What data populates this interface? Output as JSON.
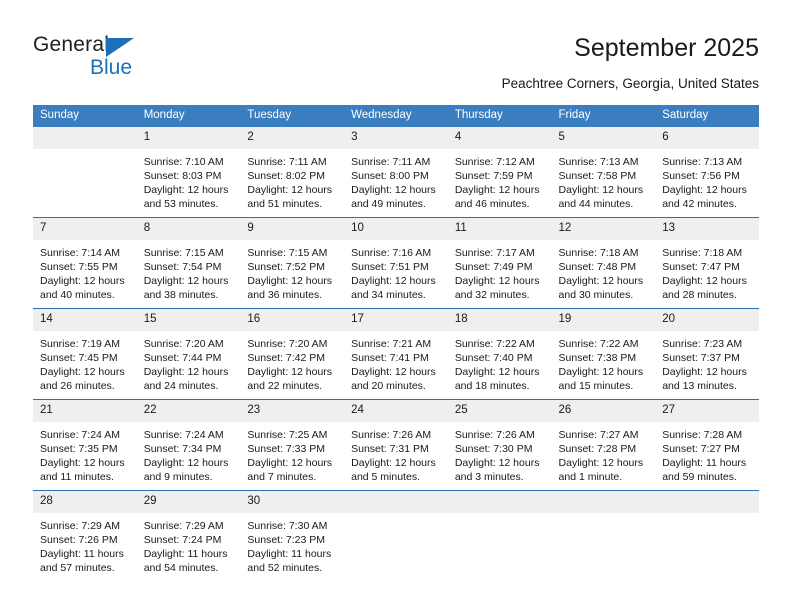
{
  "brand": {
    "name_top": "General",
    "name_bottom": "Blue",
    "accent_color": "#1d70b7"
  },
  "header": {
    "title": "September 2025",
    "subtitle": "Peachtree Corners, Georgia, United States"
  },
  "calendar": {
    "header_bg": "#3a7ebf",
    "daynum_bg": "#efefef",
    "weekday_headers": [
      "Sunday",
      "Monday",
      "Tuesday",
      "Wednesday",
      "Thursday",
      "Friday",
      "Saturday"
    ],
    "labels": {
      "sunrise": "Sunrise:",
      "sunset": "Sunset:",
      "daylight": "Daylight:"
    },
    "weeks": [
      [
        {
          "day": ""
        },
        {
          "day": "1",
          "sunrise": "Sunrise: 7:10 AM",
          "sunset": "Sunset: 8:03 PM",
          "daylight": "Daylight: 12 hours and 53 minutes."
        },
        {
          "day": "2",
          "sunrise": "Sunrise: 7:11 AM",
          "sunset": "Sunset: 8:02 PM",
          "daylight": "Daylight: 12 hours and 51 minutes."
        },
        {
          "day": "3",
          "sunrise": "Sunrise: 7:11 AM",
          "sunset": "Sunset: 8:00 PM",
          "daylight": "Daylight: 12 hours and 49 minutes."
        },
        {
          "day": "4",
          "sunrise": "Sunrise: 7:12 AM",
          "sunset": "Sunset: 7:59 PM",
          "daylight": "Daylight: 12 hours and 46 minutes."
        },
        {
          "day": "5",
          "sunrise": "Sunrise: 7:13 AM",
          "sunset": "Sunset: 7:58 PM",
          "daylight": "Daylight: 12 hours and 44 minutes."
        },
        {
          "day": "6",
          "sunrise": "Sunrise: 7:13 AM",
          "sunset": "Sunset: 7:56 PM",
          "daylight": "Daylight: 12 hours and 42 minutes."
        }
      ],
      [
        {
          "day": "7",
          "sunrise": "Sunrise: 7:14 AM",
          "sunset": "Sunset: 7:55 PM",
          "daylight": "Daylight: 12 hours and 40 minutes."
        },
        {
          "day": "8",
          "sunrise": "Sunrise: 7:15 AM",
          "sunset": "Sunset: 7:54 PM",
          "daylight": "Daylight: 12 hours and 38 minutes."
        },
        {
          "day": "9",
          "sunrise": "Sunrise: 7:15 AM",
          "sunset": "Sunset: 7:52 PM",
          "daylight": "Daylight: 12 hours and 36 minutes."
        },
        {
          "day": "10",
          "sunrise": "Sunrise: 7:16 AM",
          "sunset": "Sunset: 7:51 PM",
          "daylight": "Daylight: 12 hours and 34 minutes."
        },
        {
          "day": "11",
          "sunrise": "Sunrise: 7:17 AM",
          "sunset": "Sunset: 7:49 PM",
          "daylight": "Daylight: 12 hours and 32 minutes."
        },
        {
          "day": "12",
          "sunrise": "Sunrise: 7:18 AM",
          "sunset": "Sunset: 7:48 PM",
          "daylight": "Daylight: 12 hours and 30 minutes."
        },
        {
          "day": "13",
          "sunrise": "Sunrise: 7:18 AM",
          "sunset": "Sunset: 7:47 PM",
          "daylight": "Daylight: 12 hours and 28 minutes."
        }
      ],
      [
        {
          "day": "14",
          "sunrise": "Sunrise: 7:19 AM",
          "sunset": "Sunset: 7:45 PM",
          "daylight": "Daylight: 12 hours and 26 minutes."
        },
        {
          "day": "15",
          "sunrise": "Sunrise: 7:20 AM",
          "sunset": "Sunset: 7:44 PM",
          "daylight": "Daylight: 12 hours and 24 minutes."
        },
        {
          "day": "16",
          "sunrise": "Sunrise: 7:20 AM",
          "sunset": "Sunset: 7:42 PM",
          "daylight": "Daylight: 12 hours and 22 minutes."
        },
        {
          "day": "17",
          "sunrise": "Sunrise: 7:21 AM",
          "sunset": "Sunset: 7:41 PM",
          "daylight": "Daylight: 12 hours and 20 minutes."
        },
        {
          "day": "18",
          "sunrise": "Sunrise: 7:22 AM",
          "sunset": "Sunset: 7:40 PM",
          "daylight": "Daylight: 12 hours and 18 minutes."
        },
        {
          "day": "19",
          "sunrise": "Sunrise: 7:22 AM",
          "sunset": "Sunset: 7:38 PM",
          "daylight": "Daylight: 12 hours and 15 minutes."
        },
        {
          "day": "20",
          "sunrise": "Sunrise: 7:23 AM",
          "sunset": "Sunset: 7:37 PM",
          "daylight": "Daylight: 12 hours and 13 minutes."
        }
      ],
      [
        {
          "day": "21",
          "sunrise": "Sunrise: 7:24 AM",
          "sunset": "Sunset: 7:35 PM",
          "daylight": "Daylight: 12 hours and 11 minutes."
        },
        {
          "day": "22",
          "sunrise": "Sunrise: 7:24 AM",
          "sunset": "Sunset: 7:34 PM",
          "daylight": "Daylight: 12 hours and 9 minutes."
        },
        {
          "day": "23",
          "sunrise": "Sunrise: 7:25 AM",
          "sunset": "Sunset: 7:33 PM",
          "daylight": "Daylight: 12 hours and 7 minutes."
        },
        {
          "day": "24",
          "sunrise": "Sunrise: 7:26 AM",
          "sunset": "Sunset: 7:31 PM",
          "daylight": "Daylight: 12 hours and 5 minutes."
        },
        {
          "day": "25",
          "sunrise": "Sunrise: 7:26 AM",
          "sunset": "Sunset: 7:30 PM",
          "daylight": "Daylight: 12 hours and 3 minutes."
        },
        {
          "day": "26",
          "sunrise": "Sunrise: 7:27 AM",
          "sunset": "Sunset: 7:28 PM",
          "daylight": "Daylight: 12 hours and 1 minute."
        },
        {
          "day": "27",
          "sunrise": "Sunrise: 7:28 AM",
          "sunset": "Sunset: 7:27 PM",
          "daylight": "Daylight: 11 hours and 59 minutes."
        }
      ],
      [
        {
          "day": "28",
          "sunrise": "Sunrise: 7:29 AM",
          "sunset": "Sunset: 7:26 PM",
          "daylight": "Daylight: 11 hours and 57 minutes."
        },
        {
          "day": "29",
          "sunrise": "Sunrise: 7:29 AM",
          "sunset": "Sunset: 7:24 PM",
          "daylight": "Daylight: 11 hours and 54 minutes."
        },
        {
          "day": "30",
          "sunrise": "Sunrise: 7:30 AM",
          "sunset": "Sunset: 7:23 PM",
          "daylight": "Daylight: 11 hours and 52 minutes."
        },
        {
          "day": ""
        },
        {
          "day": ""
        },
        {
          "day": ""
        },
        {
          "day": ""
        }
      ]
    ]
  }
}
